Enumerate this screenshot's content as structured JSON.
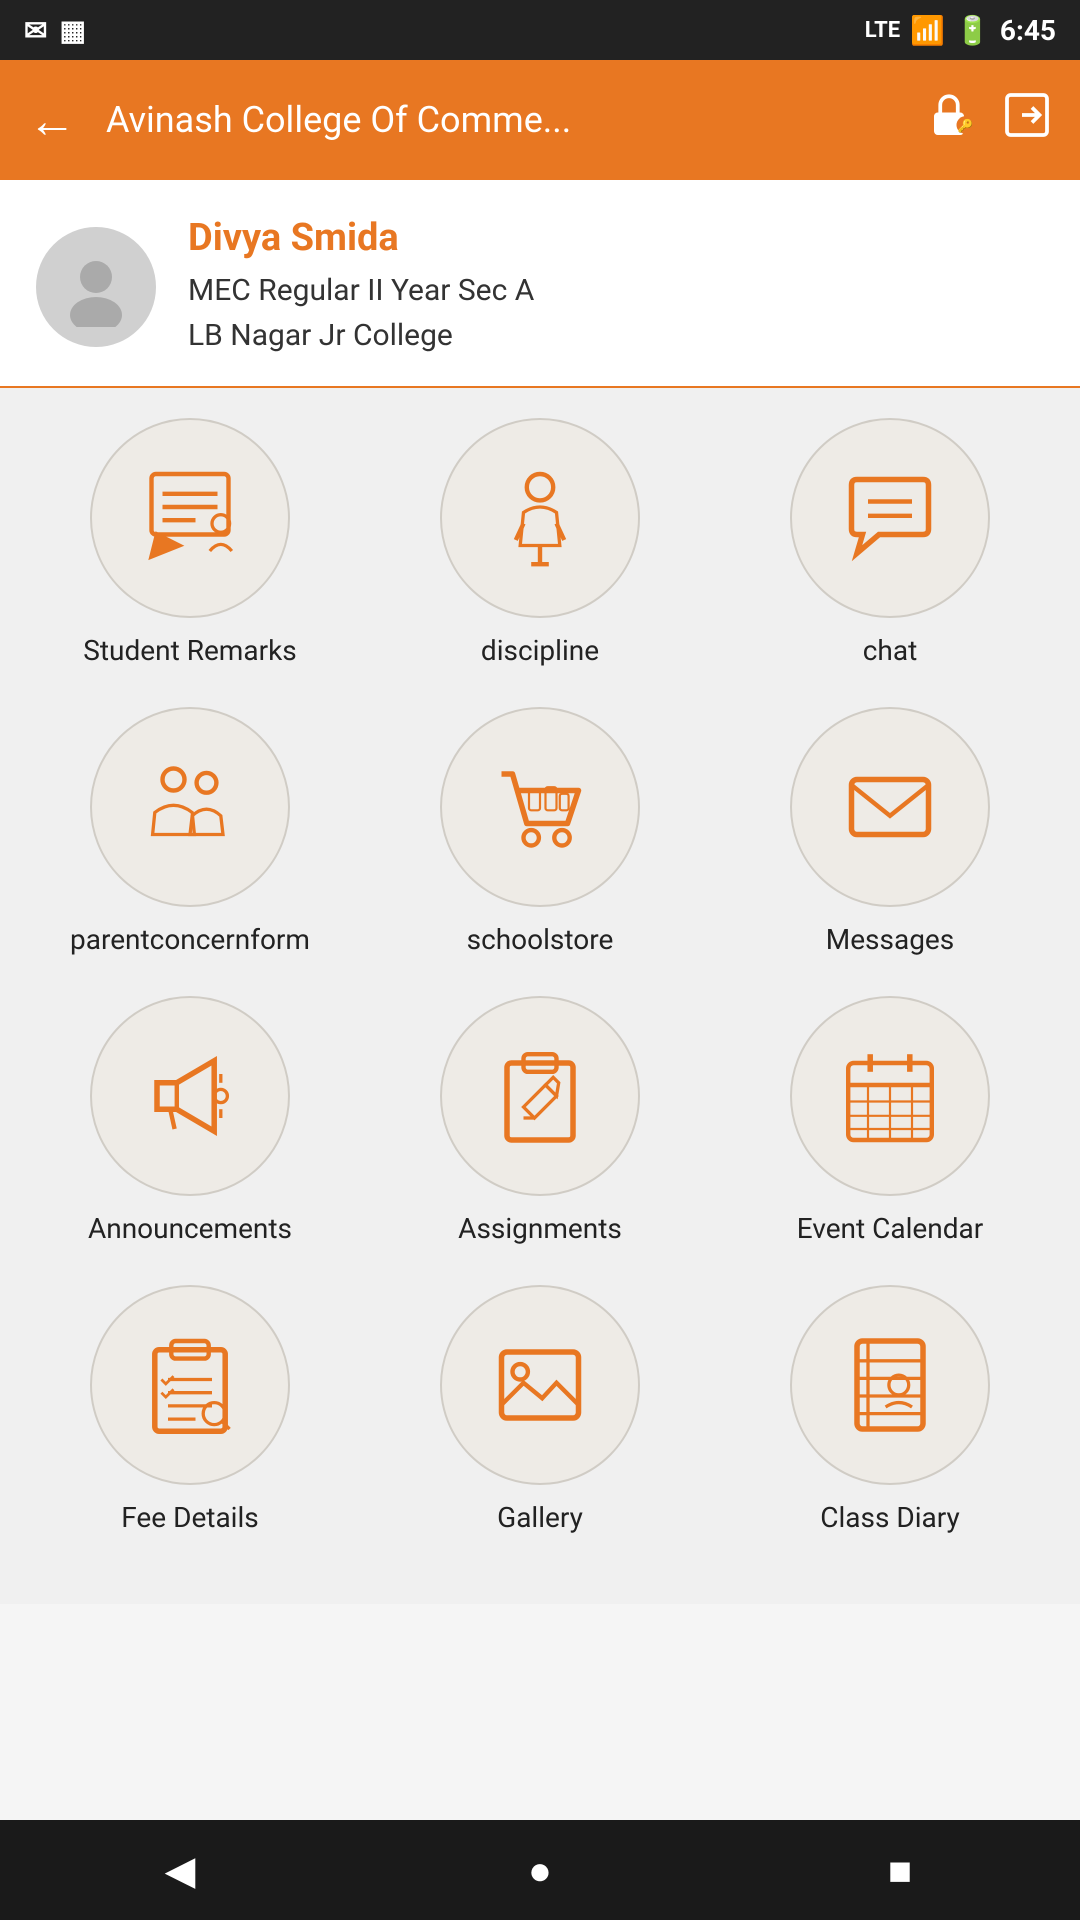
{
  "statusBar": {
    "time": "6:45",
    "network": "LTE"
  },
  "appBar": {
    "title": "Avinash College Of Comme...",
    "backLabel": "←"
  },
  "profile": {
    "name": "Divya Smida",
    "detail1": "MEC Regular II Year  Sec A",
    "detail2": "LB Nagar Jr College"
  },
  "gridItems": [
    {
      "id": "student-remarks",
      "label": "Student Remarks",
      "icon": "remarks"
    },
    {
      "id": "discipline",
      "label": "discipline",
      "icon": "discipline"
    },
    {
      "id": "chat",
      "label": "chat",
      "icon": "chat"
    },
    {
      "id": "parentconcernform",
      "label": "parentconcernform",
      "icon": "parentconcern"
    },
    {
      "id": "schoolstore",
      "label": "schoolstore",
      "icon": "store"
    },
    {
      "id": "messages",
      "label": "Messages",
      "icon": "messages"
    },
    {
      "id": "announcements",
      "label": "Announcements",
      "icon": "announcements"
    },
    {
      "id": "assignments",
      "label": "Assignments",
      "icon": "assignments"
    },
    {
      "id": "event-calendar",
      "label": "Event Calendar",
      "icon": "calendar"
    },
    {
      "id": "fee-details",
      "label": "Fee Details",
      "icon": "feedetails"
    },
    {
      "id": "gallery",
      "label": "Gallery",
      "icon": "gallery"
    },
    {
      "id": "class-diary",
      "label": "Class Diary",
      "icon": "classdiary"
    }
  ],
  "navBar": {
    "back": "◀",
    "home": "●",
    "recent": "■"
  }
}
